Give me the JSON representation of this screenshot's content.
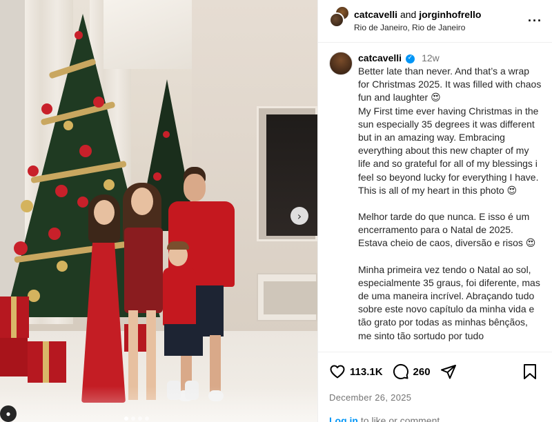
{
  "post": {
    "image_alt": "family photo in front of Christmas trees",
    "next_arrow": "›",
    "profile_badge": "●"
  },
  "header": {
    "author": "catcavelli",
    "and_text": "and",
    "coauthor": "jorginhofrello",
    "location": "Rio de Janeiro, Rio de Janeiro",
    "more_label": "···"
  },
  "caption": {
    "username": "catcavelli",
    "verified_mark": "✓",
    "time": "12w",
    "paragraphs": [
      "Better late than never. And that’s a wrap for Christmas 2025. It was filled with chaos fun and laughter 😍\nMy First time ever having Christmas in the sun especially 35 degrees it was different but in an amazing way. Embracing everything about this new chapter of my life and so grateful for all of my blessings i feel so beyond lucky for everything I have. This is all of my heart in this photo 😍",
      "Melhor tarde do que nunca. E isso é um encerramento para o Natal de 2025. Estava cheio de caos, diversão e risos 😍",
      "Minha primeira vez tendo o Natal ao sol, especialmente 35 graus, foi diferente, mas de uma maneira incrível. Abraçando tudo sobre este novo capítulo da minha vida e tão grato por todas as minhas bênçãos, me sinto tão sortudo por tudo"
    ]
  },
  "actions": {
    "likes": "113.1K",
    "comments": "260",
    "date": "December 26, 2025",
    "login_link": "Log in",
    "login_rest": " to like or comment."
  },
  "colors": {
    "link_blue": "#0095f6",
    "verified_blue": "#0095f6",
    "muted_text": "#737373"
  }
}
